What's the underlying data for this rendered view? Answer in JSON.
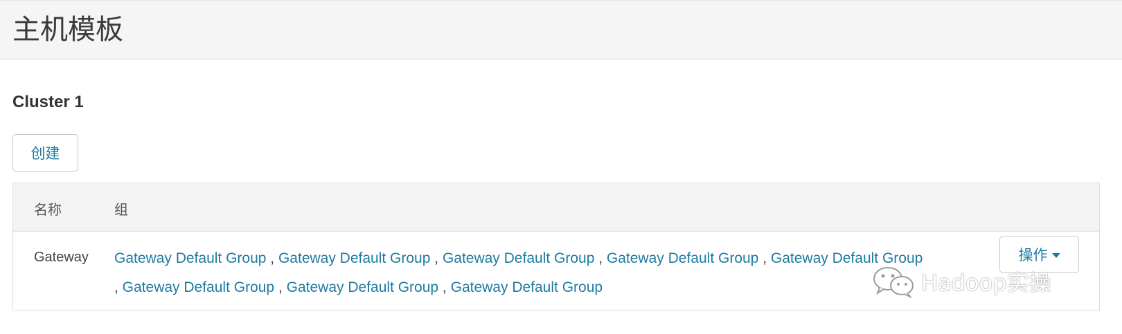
{
  "header": {
    "title": "主机模板"
  },
  "cluster": {
    "name": "Cluster 1"
  },
  "toolbar": {
    "create_label": "创建"
  },
  "table": {
    "columns": [
      "名称",
      "组"
    ],
    "rows": [
      {
        "name": "Gateway",
        "groups": [
          "Gateway Default Group",
          "Gateway Default Group",
          "Gateway Default Group",
          "Gateway Default Group",
          "Gateway Default Group",
          "Gateway Default Group",
          "Gateway Default Group",
          "Gateway Default Group"
        ],
        "action_label": "操作"
      }
    ]
  },
  "watermark": {
    "text": "Hadoop实操",
    "icon": "wechat-icon"
  },
  "colors": {
    "link": "#1f7aa1",
    "header_bg": "#f5f5f5",
    "table_header_bg": "#f3f3f3"
  }
}
